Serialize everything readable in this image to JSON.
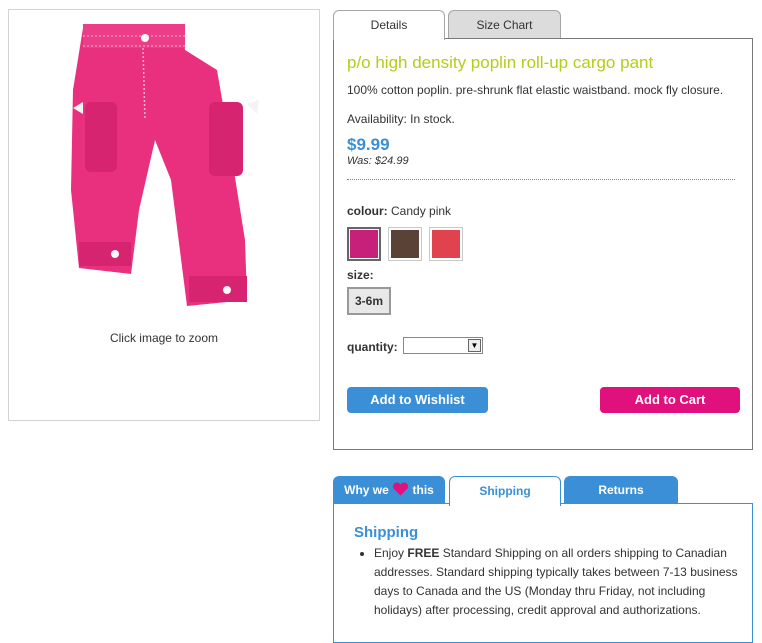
{
  "image": {
    "zoom_caption": "Click image to zoom"
  },
  "tabs": {
    "details": "Details",
    "size_chart": "Size Chart"
  },
  "product": {
    "title": "p/o high density poplin roll-up cargo pant",
    "description": "100% cotton poplin. pre-shrunk flat elastic waistband. mock fly closure.",
    "availability": "Availability: In stock.",
    "price": "$9.99",
    "was_price": "Was: $24.99",
    "colour_label": "colour:",
    "colour_value": "Candy pink",
    "swatches": [
      {
        "name": "Candy pink",
        "color": "#c7207a",
        "selected": true
      },
      {
        "name": "Brown",
        "color": "#5a4236",
        "selected": false
      },
      {
        "name": "Red",
        "color": "#e0434e",
        "selected": false
      }
    ],
    "size_label": "size:",
    "size_option": "3-6m",
    "quantity_label": "quantity:",
    "quantity_value": ""
  },
  "buttons": {
    "wishlist": "Add to Wishlist",
    "cart": "Add to Cart"
  },
  "info_tabs": {
    "why_prefix": "Why we",
    "why_suffix": "this",
    "shipping": "Shipping",
    "returns": "Returns"
  },
  "shipping": {
    "title": "Shipping",
    "bullet_prefix": "Enjoy ",
    "bullet_bold": "FREE",
    "bullet_text": " Standard Shipping on all orders shipping to Canadian addresses. Standard shipping typically takes between 7-13 business days to Canada and the US (Monday thru Friday, not including holidays) after processing, credit approval and authorizations."
  },
  "colors": {
    "accent_blue": "#3a8fd6",
    "cart_pink": "#e0117c",
    "title_green": "#b5cc18",
    "product_pink": "#e8307e"
  },
  "icons": {
    "heart": "heart-icon",
    "dropdown": "dropdown-arrow-icon"
  }
}
